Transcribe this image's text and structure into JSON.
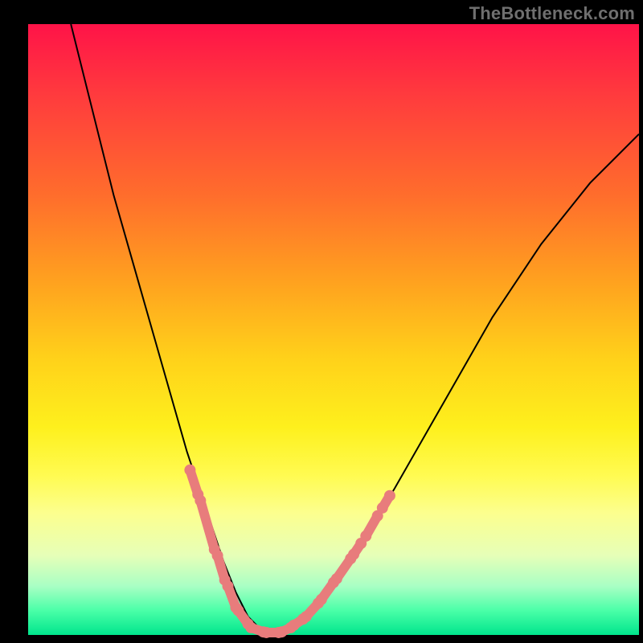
{
  "watermark": "TheBottleneck.com",
  "colors": {
    "frame": "#000000",
    "curve": "#000000",
    "ruler": "#e87c7c",
    "gradient_top": "#ff1348",
    "gradient_bottom": "#00e58c"
  },
  "chart_data": {
    "type": "line",
    "title": "",
    "xlabel": "",
    "ylabel": "",
    "xlim": [
      0,
      100
    ],
    "ylim": [
      0,
      100
    ],
    "grid": false,
    "series": [
      {
        "name": "bottleneck-curve",
        "x": [
          7,
          10,
          14,
          18,
          22,
          26,
          28,
          30,
          32,
          34,
          36,
          38,
          40,
          42,
          44,
          48,
          54,
          60,
          68,
          76,
          84,
          92,
          100
        ],
        "y": [
          100,
          88,
          72,
          58,
          44,
          30,
          24,
          18,
          12,
          7,
          3,
          1,
          0,
          0.5,
          2,
          6,
          14,
          24,
          38,
          52,
          64,
          74,
          82
        ]
      }
    ],
    "annotations": {
      "ruler_zone_description": "salmon dashed ruler marks along both branches of V near bottom (y < ~26)",
      "ruler_segments_left": [
        {
          "x1": 26.5,
          "y1": 27,
          "x2": 27.8,
          "y2": 23
        },
        {
          "x1": 28.2,
          "y1": 22,
          "x2": 30.5,
          "y2": 14
        },
        {
          "x1": 31.0,
          "y1": 13,
          "x2": 32.2,
          "y2": 9
        },
        {
          "x1": 32.7,
          "y1": 8,
          "x2": 34.0,
          "y2": 4.5
        },
        {
          "x1": 34.4,
          "y1": 4,
          "x2": 36.0,
          "y2": 1.8
        }
      ],
      "ruler_segments_bottom": [
        {
          "x1": 36.5,
          "y1": 1.2,
          "x2": 38.5,
          "y2": 0.5
        },
        {
          "x1": 39.0,
          "y1": 0.4,
          "x2": 41.0,
          "y2": 0.4
        },
        {
          "x1": 41.5,
          "y1": 0.5,
          "x2": 43.0,
          "y2": 1.2
        },
        {
          "x1": 43.5,
          "y1": 1.6,
          "x2": 45.0,
          "y2": 2.6
        }
      ],
      "ruler_segments_right": [
        {
          "x1": 45.5,
          "y1": 3.0,
          "x2": 47.5,
          "y2": 5.2
        },
        {
          "x1": 48.0,
          "y1": 5.8,
          "x2": 50.0,
          "y2": 8.6
        },
        {
          "x1": 50.5,
          "y1": 9.2,
          "x2": 52.8,
          "y2": 12.5
        },
        {
          "x1": 53.3,
          "y1": 13.2,
          "x2": 54.5,
          "y2": 15.0
        },
        {
          "x1": 55.3,
          "y1": 16.2,
          "x2": 57.2,
          "y2": 19.5
        },
        {
          "x1": 58.0,
          "y1": 20.8,
          "x2": 59.2,
          "y2": 22.8
        }
      ]
    }
  }
}
